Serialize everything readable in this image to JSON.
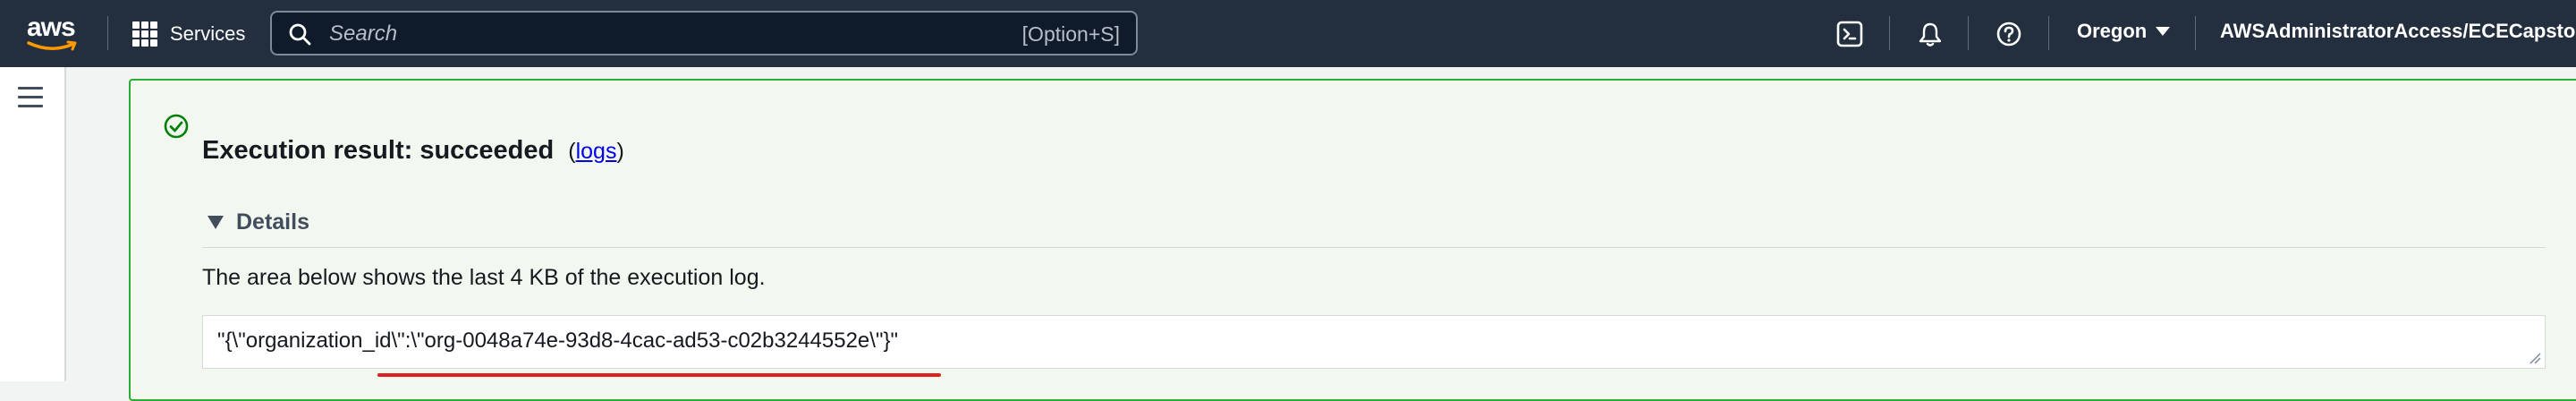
{
  "topnav": {
    "logo_text": "aws",
    "services_label": "Services",
    "search": {
      "placeholder": "Search",
      "shortcut": "[Option+S]"
    },
    "icons": [
      "cloudshell-icon",
      "notifications-icon",
      "help-icon"
    ],
    "region": "Oregon",
    "account": "AWSAdministratorAccess/ECECapstone.D"
  },
  "result": {
    "title": "Execution result: succeeded",
    "paren_open": "(",
    "logs_link": "logs",
    "paren_close": ")",
    "details_label": "Details",
    "description": "The area below shows the last 4 KB of the execution log.",
    "log_output": "\"{\\\"organization_id\\\":\\\"org-0048a74e-93d8-4cac-ad53-c02b3244552e\\\"}\""
  },
  "colors": {
    "nav_bg": "#232f3e",
    "success_border": "#29ad32",
    "success_bg": "#f2f8f0",
    "annotation_red": "#e02020",
    "link": "#0000ee"
  }
}
